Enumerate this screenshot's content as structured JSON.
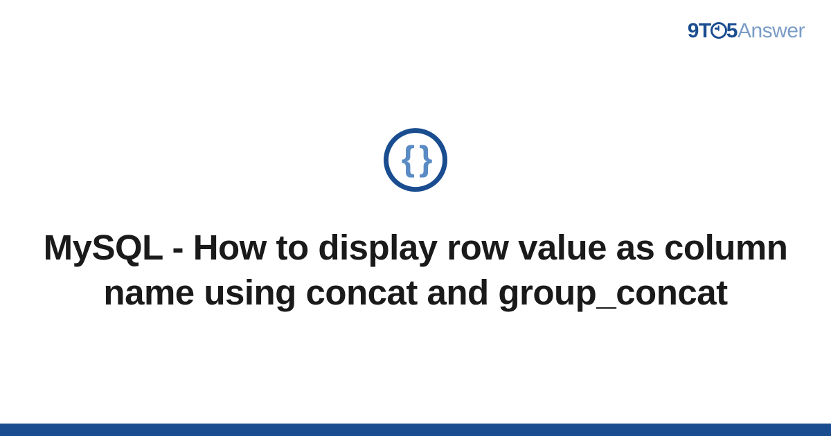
{
  "logo": {
    "prefix": "9T",
    "suffix": "5",
    "word": "Answer"
  },
  "icon": {
    "glyph": "{ }"
  },
  "title": "MySQL - How to display row value as column name using concat and group_concat"
}
